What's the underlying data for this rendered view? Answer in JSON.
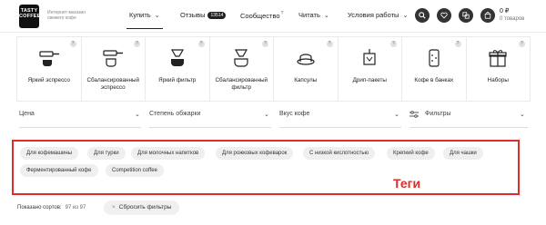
{
  "header": {
    "logo_text": "TASTY COFFEE",
    "tagline": "Интернет-магазин свежего кофе",
    "nav": {
      "buy": "Купить",
      "reviews": "Отзывы",
      "reviews_badge": "13514",
      "community": "Сообщество",
      "community_sup": "?",
      "read": "Читать",
      "terms": "Условия работы"
    },
    "cart": {
      "price": "0 ₽",
      "items": "0 товаров"
    }
  },
  "categories": [
    {
      "label": "Яркий эспрессо",
      "icon": "espresso-portafilter-icon"
    },
    {
      "label": "Сбалансированный эспрессо",
      "icon": "portafilter-cup-icon"
    },
    {
      "label": "Яркий фильтр",
      "icon": "filter-dripper-icon"
    },
    {
      "label": "Сбалансированный фильтр",
      "icon": "filter-cup-icon"
    },
    {
      "label": "Капсулы",
      "icon": "capsule-icon"
    },
    {
      "label": "Дрип-пакеты",
      "icon": "drip-bag-icon"
    },
    {
      "label": "Кофе в банках",
      "icon": "can-icon"
    },
    {
      "label": "Наборы",
      "icon": "gift-box-icon"
    }
  ],
  "filters": {
    "price": "Цена",
    "roast": "Степень обжарки",
    "taste": "Вкус кофе",
    "more": "Фильтры"
  },
  "tags": [
    "Для кофемашины",
    "Для турки",
    "Для молочных напитков",
    "Для рожковых кофеварок",
    "С низкой кислотностью",
    "Крепкий кофе",
    "Для чашки",
    "Ферментированный кофе",
    "Competition coffee"
  ],
  "annotation": "Теги",
  "results": {
    "label": "Показано сортов:",
    "count": "97 из 97",
    "reset": "Сбросить фильтры"
  },
  "colors": {
    "annotation_red": "#e02b2b",
    "dark": "#333333",
    "tag_bg": "#efefef"
  }
}
